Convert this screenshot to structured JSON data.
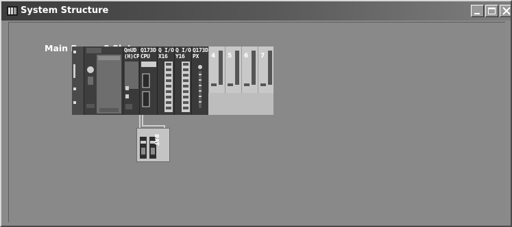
{
  "window": {
    "title": "System Structure",
    "controls": {
      "minimize": "minimize-icon",
      "maximize": "maximize-icon",
      "close": "close-icon"
    }
  },
  "main": {
    "base_label": "Main Base : 8 Slots"
  },
  "rack": {
    "modules": [
      {
        "id": "power",
        "label": ""
      },
      {
        "id": "cpu1",
        "label": "QnUD\n(H)CPU"
      },
      {
        "id": "cpu2",
        "label": "Q173D\nCPU"
      },
      {
        "id": "io1",
        "label": "Q I/O\nX16"
      },
      {
        "id": "io2",
        "label": "Q I/O\nY16"
      },
      {
        "id": "px",
        "label": "Q173D\nPX"
      },
      {
        "id": "slot4",
        "label": "4"
      },
      {
        "id": "slot5",
        "label": "5"
      },
      {
        "id": "slot6",
        "label": "6"
      },
      {
        "id": "slot7",
        "label": "7"
      }
    ]
  },
  "battery": {
    "label": "BAT"
  },
  "colors": {
    "client_bg": "#898989",
    "titlebar": "#3c3c3c",
    "module_dark": "#3a3a3a",
    "module_light": "#c8c8c8"
  }
}
